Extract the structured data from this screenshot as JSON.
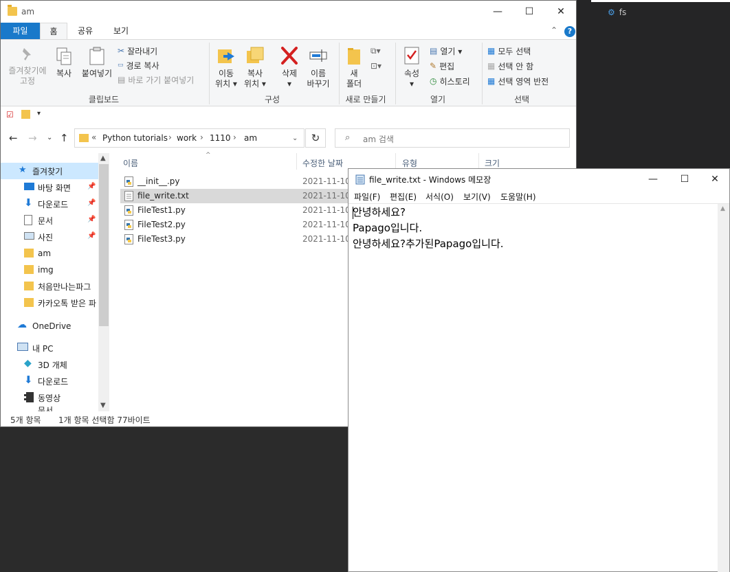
{
  "background_app": {
    "item": "fs"
  },
  "explorer": {
    "title": "am",
    "tabs": {
      "file": "파일",
      "home": "홈",
      "share": "공유",
      "view": "보기"
    },
    "ribbon": {
      "pin": "즐겨찾기에\n고정",
      "pin_l1": "즐겨찾기에",
      "pin_l2": "고정",
      "copy": "복사",
      "paste": "붙여넣기",
      "cut": "잘라내기",
      "copy_path": "경로 복사",
      "paste_shortcut": "바로 가기 붙여넣기",
      "clipboard_group": "클립보드",
      "move_l1": "이동",
      "move_l2": "위치 ▾",
      "copyto_l1": "복사",
      "copyto_l2": "위치 ▾",
      "delete_l1": "삭제",
      "delete_l2": "▾",
      "rename_l1": "이름",
      "rename_l2": "바꾸기",
      "organize_group": "구성",
      "new_folder_l1": "새",
      "new_folder_l2": "폴더",
      "new_group": "새로 만들기",
      "properties_l1": "속성",
      "properties_l2": "▾",
      "open": "열기 ▾",
      "edit": "편집",
      "history": "히스토리",
      "open_group": "열기",
      "select_all": "모두 선택",
      "select_none": "선택 안 함",
      "invert": "선택 영역 반전",
      "select_group": "선택"
    },
    "address": {
      "overflow": "«",
      "crumbs": [
        "Python tutorials",
        "work",
        "1110",
        "am"
      ],
      "search_placeholder": "am 검색"
    },
    "nav": {
      "quick_access": "즐겨찾기",
      "items": [
        "바탕 화면",
        "다운로드",
        "문서",
        "사진",
        "am",
        "img",
        "처음만나는파그",
        "카카오톡 받은 파"
      ],
      "onedrive": "OneDrive",
      "this_pc": "내 PC",
      "pc_items": [
        "3D 개체",
        "다운로드",
        "동영상",
        "문서"
      ]
    },
    "columns": {
      "name": "이름",
      "modified": "수정한 날짜",
      "type": "유형",
      "size": "크기"
    },
    "files": [
      {
        "name": "__init__.py",
        "date": "2021-11-10"
      },
      {
        "name": "file_write.txt",
        "date": "2021-11-10"
      },
      {
        "name": "FileTest1.py",
        "date": "2021-11-10"
      },
      {
        "name": "FileTest2.py",
        "date": "2021-11-10"
      },
      {
        "name": "FileTest3.py",
        "date": "2021-11-10"
      }
    ],
    "status": {
      "count": "5개 항목",
      "selection": "1개 항목 선택함 77바이트"
    }
  },
  "notepad": {
    "title": "file_write.txt - Windows 메모장",
    "menu": [
      "파일(F)",
      "편집(E)",
      "서식(O)",
      "보기(V)",
      "도움말(H)"
    ],
    "lines": [
      "안녕하세요?",
      "Papago입니다.",
      "안녕하세요?추가된Papago입니다."
    ]
  },
  "colors": {
    "accent": "#1979ca",
    "selection": "#cce8ff",
    "folder": "#f3c44d"
  }
}
